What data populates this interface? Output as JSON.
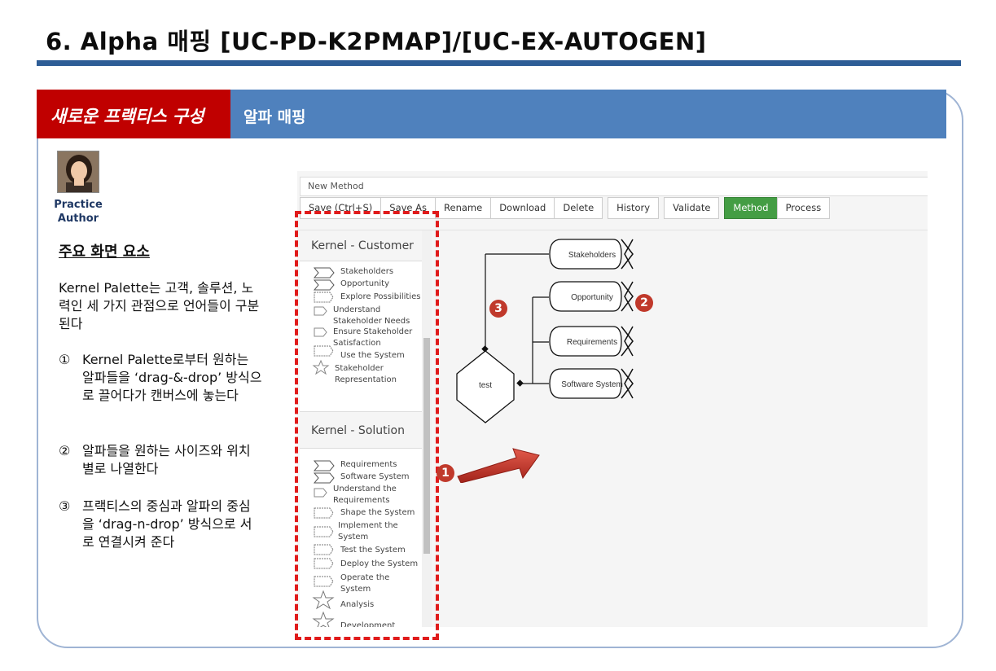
{
  "slide": {
    "title": "6. Alpha 매핑 [UC-PD-K2PMAP]/[UC-EX-AUTOGEN]",
    "header_left": "새로운 프랙티스 구성",
    "header_right": "알파 매핑"
  },
  "author": {
    "role_line1": "Practice",
    "role_line2": "Author"
  },
  "content": {
    "section_title": "주요 화면 요소",
    "description": "Kernel Palette는 고객, 솔루션, 노력인 세 가지 관점으로 언어들이 구분된다",
    "steps": [
      {
        "num": "①",
        "text": "Kernel Palette로부터 원하는 알파들을 ‘drag-&-drop’ 방식으로 끌어다가 캔버스에 놓는다"
      },
      {
        "num": "②",
        "text": "알파들을 원하는 사이즈와 위치 별로 나열한다"
      },
      {
        "num": "③",
        "text": "프랙티스의 중심과 알파의 중심을 ‘drag-n-drop’ 방식으로 서로 연결시켜 준다"
      }
    ]
  },
  "app": {
    "method_name": "New Method",
    "toolbar": [
      "Save (Ctrl+S)",
      "Save As",
      "Rename",
      "Download",
      "Delete",
      "History",
      "Validate",
      "Method",
      "Process"
    ],
    "active_toolbar": "Method",
    "accent_color": "#449d44",
    "palette": {
      "customer_title": "Kernel - Customer",
      "customer_items": [
        "Stakeholders",
        "Opportunity",
        "Explore Possibilities",
        "Understand Stakeholder Needs",
        "Ensure Stakeholder Satisfaction",
        "Use the System",
        "Stakeholder Representation"
      ],
      "solution_title": "Kernel - Solution",
      "solution_items": [
        "Requirements",
        "Software System",
        "Understand the Requirements",
        "Shape the System",
        "Implement the System",
        "Test the System",
        "Deploy the System",
        "Operate the System",
        "Analysis",
        "Development"
      ]
    },
    "canvas": {
      "practice_label": "test",
      "alphas": [
        "Stakeholders",
        "Opportunity",
        "Requirements",
        "Software System"
      ]
    }
  },
  "callouts": {
    "one": "1",
    "two": "2",
    "three": "3"
  },
  "colors": {
    "header_red": "#c00000",
    "header_blue": "#4f81bd",
    "title_rule": "#2e5d96",
    "callout": "#c0392b"
  }
}
